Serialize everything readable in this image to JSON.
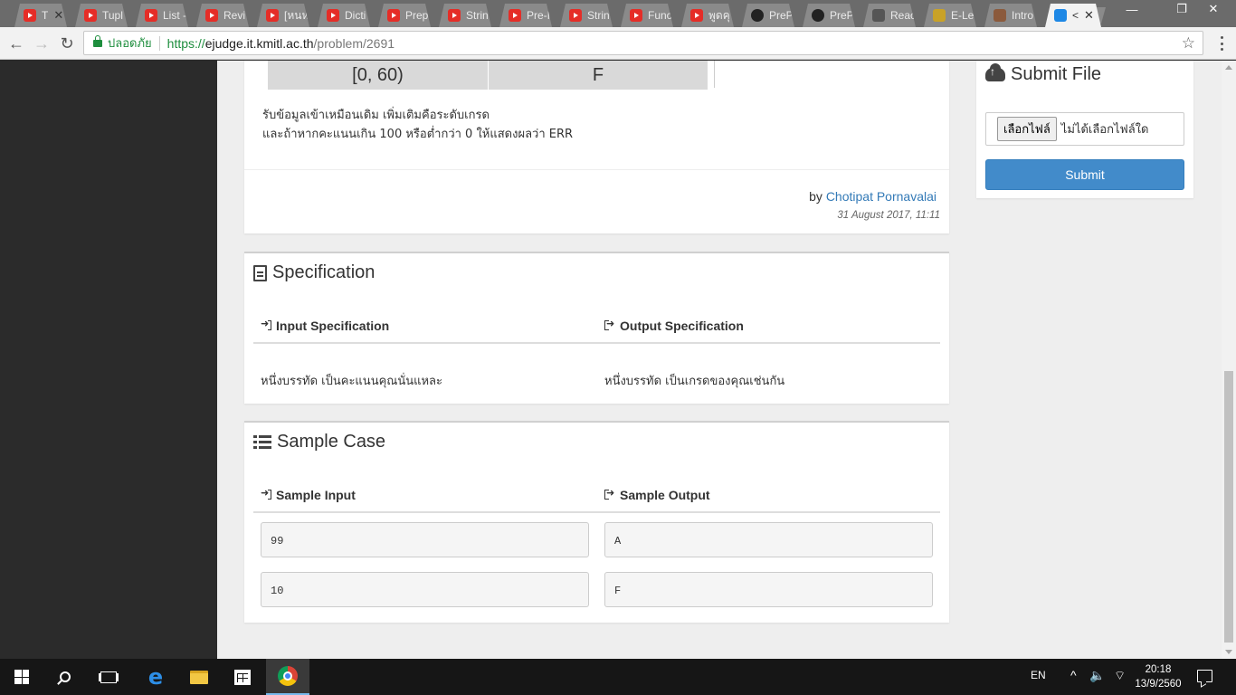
{
  "browser": {
    "tabs": [
      {
        "label": "T",
        "icon": "youtube-icon",
        "active": false
      },
      {
        "label": "Tupl",
        "icon": "youtube-icon",
        "active": false
      },
      {
        "label": "List -",
        "icon": "youtube-icon",
        "active": false
      },
      {
        "label": "Revi",
        "icon": "youtube-icon",
        "active": false
      },
      {
        "label": "[หนห",
        "icon": "youtube-icon",
        "active": false
      },
      {
        "label": "Dicti",
        "icon": "youtube-icon",
        "active": false
      },
      {
        "label": "Prep",
        "icon": "youtube-icon",
        "active": false
      },
      {
        "label": "Strin",
        "icon": "youtube-icon",
        "active": false
      },
      {
        "label": "Pre-I",
        "icon": "youtube-icon",
        "active": false
      },
      {
        "label": "Strin",
        "icon": "youtube-icon",
        "active": false
      },
      {
        "label": "Func",
        "icon": "youtube-icon",
        "active": false
      },
      {
        "label": "พูดคุ",
        "icon": "youtube-icon",
        "active": false
      },
      {
        "label": "PreP",
        "icon": "github-icon",
        "active": false
      },
      {
        "label": "PreP",
        "icon": "github-icon",
        "active": false
      },
      {
        "label": "Reac",
        "icon": "reader-icon",
        "active": false
      },
      {
        "label": "E-Le",
        "icon": "elearning-icon",
        "active": false
      },
      {
        "label": "Intro",
        "icon": "intro-icon",
        "active": false
      },
      {
        "label": "<",
        "icon": "kmitl-icon",
        "active": true
      }
    ],
    "tab_close_glyph": "✕",
    "security_label": "ปลอดภัย",
    "url": {
      "scheme": "https://",
      "host": "ejudge.it.kmitl.ac.th",
      "path": "/problem/2691"
    }
  },
  "problem": {
    "grade_table_last_row": {
      "range": "[0, 60)",
      "grade": "F"
    },
    "description_lines": [
      "รับข้อมูลเข้าเหมือนเดิม เพิ่มเติมคือระดับเกรด",
      "และถ้าหากคะแนนเกิน 100 หรือต่ำกว่า 0 ให้แสดงผลว่า ERR"
    ],
    "by_prefix": "by",
    "author": "Chotipat Pornavalai",
    "date": "31 August 2017, 11:11"
  },
  "specification": {
    "title": "Specification",
    "input_heading": "Input Specification",
    "output_heading": "Output Specification",
    "input_text": "หนึ่งบรรทัด เป็นคะแนนคุณนั่นแหละ",
    "output_text": "หนึ่งบรรทัด เป็นเกรดของคุณเช่นกัน"
  },
  "sample_case": {
    "title": "Sample Case",
    "input_heading": "Sample Input",
    "output_heading": "Sample Output",
    "rows": [
      {
        "input": "99",
        "output": "A"
      },
      {
        "input": "10",
        "output": "F"
      }
    ]
  },
  "submit": {
    "title": "Submit File",
    "choose_file_label": "เลือกไฟล์",
    "no_file_text": "ไม่ได้เลือกไฟล์ใด",
    "submit_label": "Submit"
  },
  "taskbar": {
    "language": "EN",
    "time": "20:18",
    "date": "13/9/2560"
  }
}
